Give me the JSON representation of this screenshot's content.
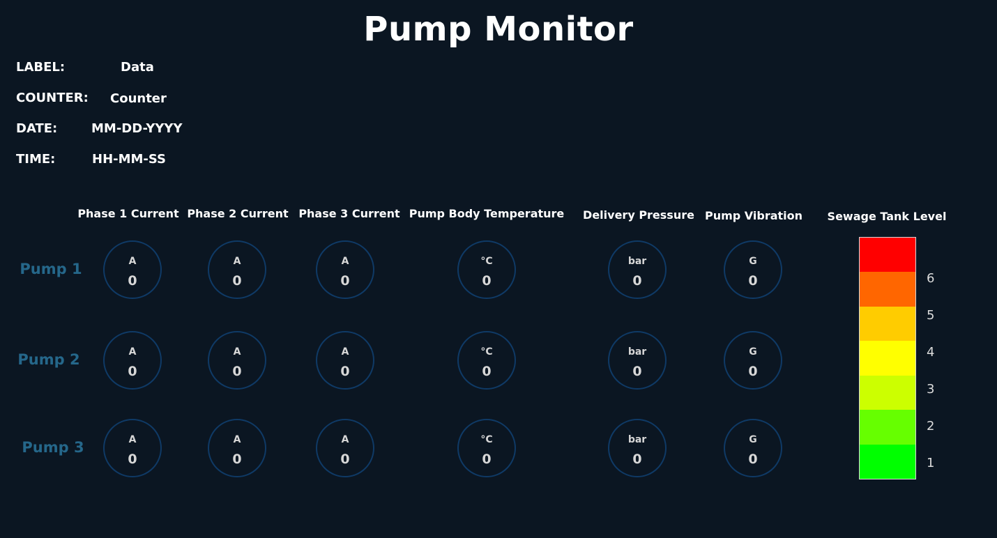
{
  "title": "Pump Monitor",
  "info": {
    "label_key": "LABEL:",
    "label_value": "Data",
    "counter_key": "COUNTER:",
    "counter_value": "Counter",
    "date_key": "DATE:",
    "date_value": "MM-DD-YYYY",
    "time_key": "TIME:",
    "time_value": "HH-MM-SS"
  },
  "columns": [
    {
      "header": "Phase 1 Current",
      "unit": "A"
    },
    {
      "header": "Phase 2 Current",
      "unit": "A"
    },
    {
      "header": "Phase 3 Current",
      "unit": "A"
    },
    {
      "header": "Pump Body Temperature",
      "unit": "°C"
    },
    {
      "header": "Delivery Pressure",
      "unit": "bar"
    },
    {
      "header": "Pump Vibration",
      "unit": "G"
    }
  ],
  "pumps": [
    {
      "name": "Pump 1",
      "values": [
        "0",
        "0",
        "0",
        "0",
        "0",
        "0"
      ]
    },
    {
      "name": "Pump 2",
      "values": [
        "0",
        "0",
        "0",
        "0",
        "0",
        "0"
      ]
    },
    {
      "name": "Pump 3",
      "values": [
        "0",
        "0",
        "0",
        "0",
        "0",
        "0"
      ]
    }
  ],
  "tank": {
    "title": "Sewage Tank Level",
    "segments": [
      "#ff0000",
      "#ff6600",
      "#ffcc00",
      "#ffff00",
      "#ccff00",
      "#66ff00",
      "#00ff00"
    ],
    "ticks": [
      "6",
      "5",
      "4",
      "3",
      "2",
      "1"
    ]
  },
  "colors": {
    "background": "#0b1622",
    "pump_label": "#25678a",
    "gauge_border": "#0f3a66"
  }
}
